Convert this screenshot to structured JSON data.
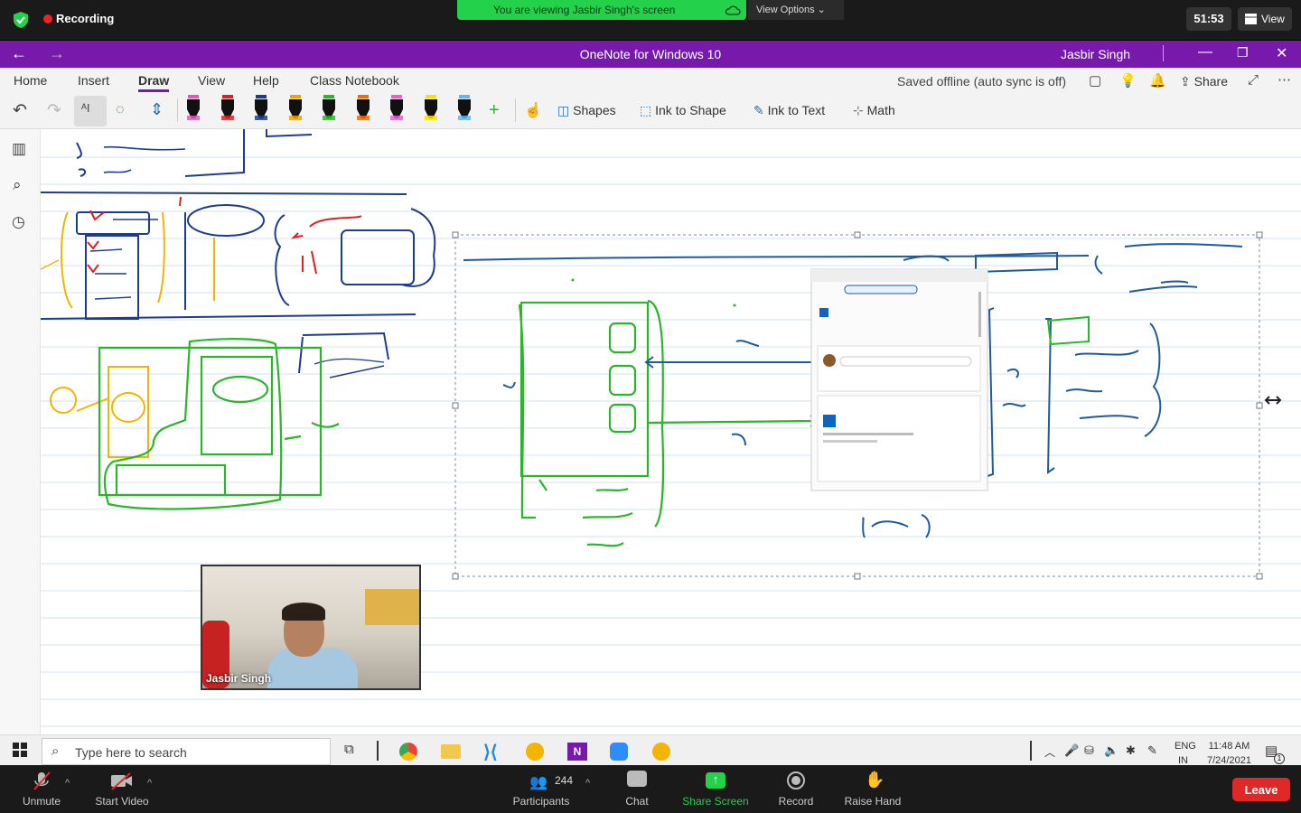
{
  "zoom": {
    "recording_label": "Recording",
    "viewing_banner": "You are viewing Jasbir Singh's screen",
    "view_options": "View Options",
    "timer": "51:53",
    "view_button": "View",
    "bottom": {
      "unmute": "Unmute",
      "start_video": "Start Video",
      "participants": "Participants",
      "participant_count": "244",
      "chat": "Chat",
      "share_screen": "Share Screen",
      "record": "Record",
      "raise_hand": "Raise Hand",
      "leave": "Leave"
    },
    "participant_name": "Jasbir Singh",
    "share_color": "#23d14b",
    "leave_color": "#e02828"
  },
  "onenote": {
    "title": "OneNote for Windows 10",
    "user": "Jasbir Singh",
    "accent": "#7719aa",
    "tabs": [
      "Home",
      "Insert",
      "Draw",
      "View",
      "Help",
      "Class Notebook"
    ],
    "active_tab": "Draw",
    "saved_status": "Saved offline (auto sync is off)",
    "share": "Share",
    "tools": {
      "shapes": "Shapes",
      "ink_to_shape": "Ink to Shape",
      "ink_to_text": "Ink to Text",
      "math": "Math"
    },
    "pen_colors": [
      "#e05bb5",
      "#e02020",
      "#1f3c8c",
      "#f2a100",
      "#2bb52b",
      "#f56a00",
      "#e85fd0",
      "#f5e400",
      "#5fb6f0"
    ]
  },
  "taskbar": {
    "search_placeholder": "Type here to search",
    "lang": "ENG",
    "region": "IN",
    "time": "11:48 AM",
    "date": "7/24/2021",
    "notification_count": "1"
  }
}
